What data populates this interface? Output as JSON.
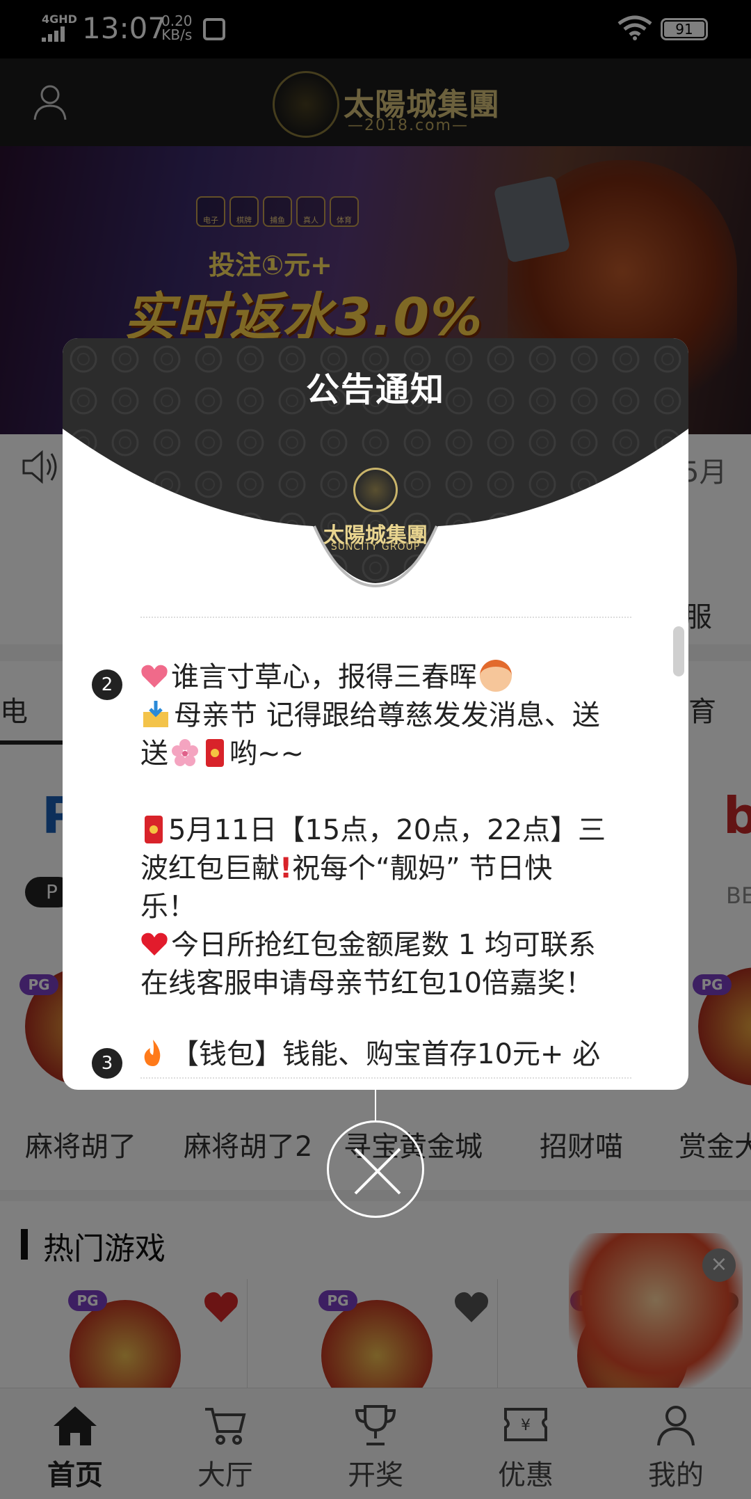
{
  "status_bar": {
    "network": "4GHD",
    "time": "13:07",
    "speed_value": "0.20",
    "speed_unit": "KB/s",
    "battery": "91"
  },
  "header": {
    "logo_title": "太陽城集團",
    "logo_sub": "—2018.com—"
  },
  "banner": {
    "categories": [
      "电子",
      "棋牌",
      "捕鱼",
      "真人",
      "体育"
    ],
    "line1": "投注①元+",
    "line2": "实时返水3.0%"
  },
  "notice_bar": {
    "text_tail": "5月"
  },
  "quick_row": {
    "label_tail": "服"
  },
  "category_tabs": {
    "left_label": "电",
    "right_label": "育"
  },
  "providers": {
    "left_logo": "P",
    "left_pill": "P",
    "right_logo": "b",
    "right_label": "BE"
  },
  "games_row": {
    "items": [
      {
        "name": "麻将胡了",
        "badge": "PG"
      },
      {
        "name": "麻将胡了2",
        "badge": ""
      },
      {
        "name": "寻宝黄金城",
        "badge": ""
      },
      {
        "name": "招财喵",
        "badge": ""
      },
      {
        "name": "赏金大",
        "badge": "PG"
      }
    ]
  },
  "hot_games": {
    "title": "热门游戏",
    "cards": [
      {
        "badge": "PG"
      },
      {
        "badge": "PG"
      },
      {
        "badge": "PG"
      }
    ],
    "promo_close": "×"
  },
  "bottom_nav": {
    "items": [
      {
        "label": "首页",
        "icon": "home-icon"
      },
      {
        "label": "大厅",
        "icon": "cart-icon"
      },
      {
        "label": "开奖",
        "icon": "trophy-icon"
      },
      {
        "label": "优惠",
        "icon": "coupon-icon"
      },
      {
        "label": "我的",
        "icon": "person-icon"
      }
    ]
  },
  "modal": {
    "title": "公告通知",
    "logo_text": "太陽城集團",
    "logo_sub": "SUNCITY GROUP",
    "items": [
      {
        "number": "2",
        "lines": [
          "谁言寸草心，报得三春晖",
          "母亲节 记得跟给尊慈发发消息、送",
          "送",
          "哟~~",
          "5月11日【15点，20点，22点】三",
          "波红包巨献",
          "祝每个“靓妈” 节日快",
          "乐！",
          "今日所抢红包金额尾数 1 均可联系",
          "在线客服申请母亲节红包10倍嘉奖！"
        ]
      },
      {
        "number": "3",
        "lines": [
          "【钱包】钱能、购宝首存10元+ 必"
        ]
      }
    ]
  },
  "colors": {
    "header_bg": "#1a1a1a",
    "gold": "#d8c27a",
    "modal_head": "#2b2b2b",
    "red": "#d8232a"
  }
}
